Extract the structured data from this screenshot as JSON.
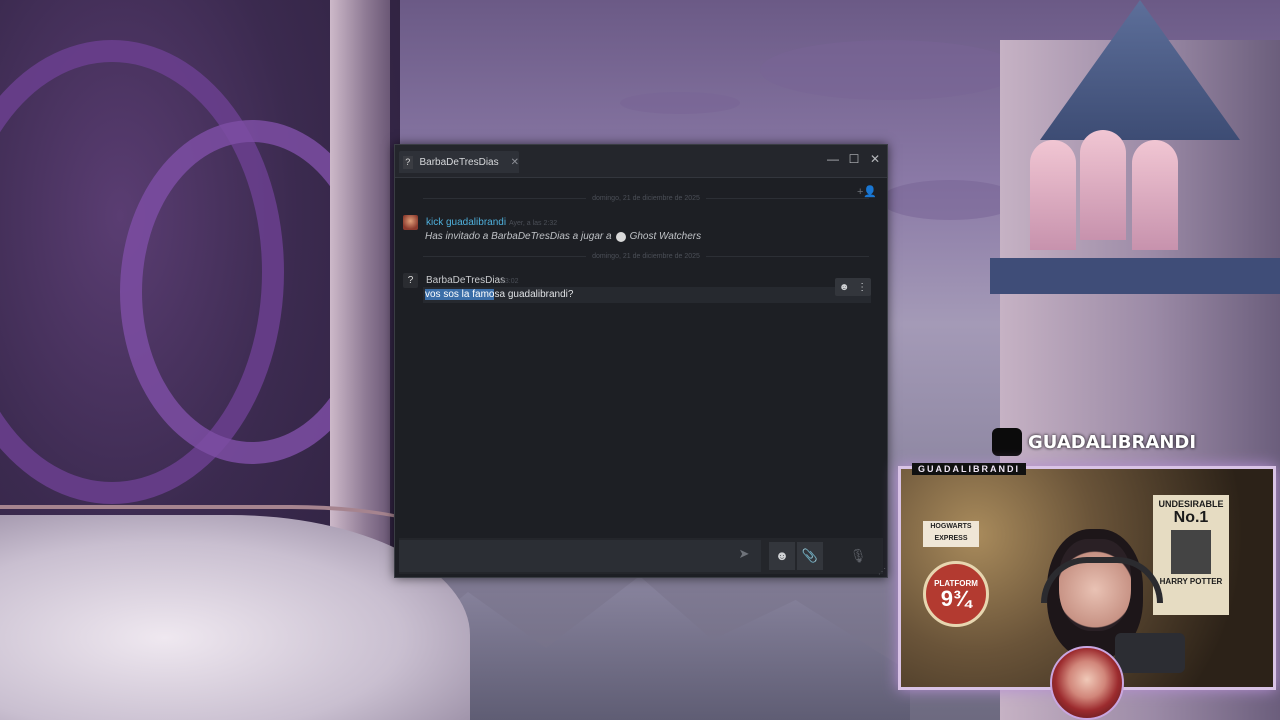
{
  "chat_window": {
    "tab": {
      "avatar_glyph": "?",
      "name": "BarbaDeTresDias",
      "close_glyph": "✕"
    },
    "window_controls": {
      "minimize": "—",
      "maximize": "☐",
      "close": "✕"
    },
    "add_friend_glyph": "+👤",
    "date_separator_1": "domingo, 21 de diciembre de 2025",
    "date_separator_2": "domingo, 21 de diciembre de 2025",
    "messages": [
      {
        "sender": "kick guadalibrandi",
        "timestamp": "Ayer, a las 2:32",
        "invite_text": "Has invitado a BarbaDeTresDias a jugar a",
        "game": "Ghost Watchers"
      },
      {
        "sender": "BarbaDeTresDias",
        "avatar_glyph": "?",
        "timestamp": "23:02",
        "text_selected": "vos sos la famo",
        "text_rest": "sa guadalibrandi?"
      }
    ],
    "message_actions": {
      "emoji": "☻",
      "more": "⋮"
    },
    "composer": {
      "placeholder": "",
      "send": "➤",
      "emoji": "☻",
      "attach": "📎",
      "voice": "🎙"
    }
  },
  "stream_overlay": {
    "brand_name": "GUADALIBRANDI",
    "cam_label": "GUADALIBRANDI",
    "poster_hogwarts": "HOGWARTS EXPRESS",
    "poster_platform_top": "PLATFORM",
    "poster_platform_num": "9¾",
    "poster_wanted_top": "UNDESIRABLE",
    "poster_wanted_num": "No.1",
    "poster_wanted_name": "HARRY POTTER"
  }
}
